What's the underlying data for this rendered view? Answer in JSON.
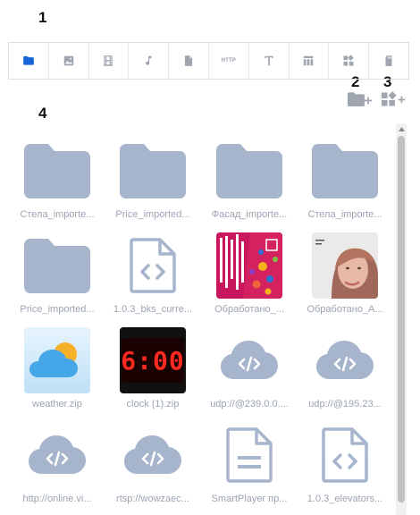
{
  "callouts": [
    "1",
    "2",
    "3",
    "4"
  ],
  "colors": {
    "accent": "#1565d8",
    "icon_gray": "#a0a6b0",
    "file_icon": "#9fb0c8",
    "label": "#9ca4b2"
  },
  "toolbar": {
    "tabs": [
      {
        "icon": "folder-icon",
        "active": true
      },
      {
        "icon": "image-icon"
      },
      {
        "icon": "film-icon"
      },
      {
        "icon": "music-icon"
      },
      {
        "icon": "document-icon"
      },
      {
        "icon": "http-icon",
        "text": "HTTP"
      },
      {
        "icon": "text-icon"
      },
      {
        "icon": "table-icon"
      },
      {
        "icon": "widgets-icon"
      },
      {
        "icon": "sd-card-icon"
      }
    ]
  },
  "actions": [
    {
      "icon": "new-folder-icon"
    },
    {
      "icon": "add-widget-icon"
    }
  ],
  "files": [
    {
      "name": "Стела_importe...",
      "type": "folder"
    },
    {
      "name": "Price_imported...",
      "type": "folder"
    },
    {
      "name": "Фасад_importe...",
      "type": "folder"
    },
    {
      "name": "Стела_importe...",
      "type": "folder"
    },
    {
      "name": "Price_imported...",
      "type": "folder"
    },
    {
      "name": "1.0.3_bks_curre...",
      "type": "code-file"
    },
    {
      "name": "Обработано_...",
      "type": "image-poster"
    },
    {
      "name": "Обработано_А...",
      "type": "image-portrait"
    },
    {
      "name": "weather.zip",
      "type": "weather-app"
    },
    {
      "name": "clock (1).zip",
      "type": "clock-app",
      "clock_text": "6:00"
    },
    {
      "name": "udp://@239.0.0....",
      "type": "cloud-stream"
    },
    {
      "name": "udp://@195.23...",
      "type": "cloud-stream"
    },
    {
      "name": "http://online.vi...",
      "type": "cloud-stream"
    },
    {
      "name": "rtsp://wowzaec...",
      "type": "cloud-stream"
    },
    {
      "name": "SmartPlayer пр...",
      "type": "text-file"
    },
    {
      "name": "1.0.3_elevators...",
      "type": "code-file"
    }
  ]
}
